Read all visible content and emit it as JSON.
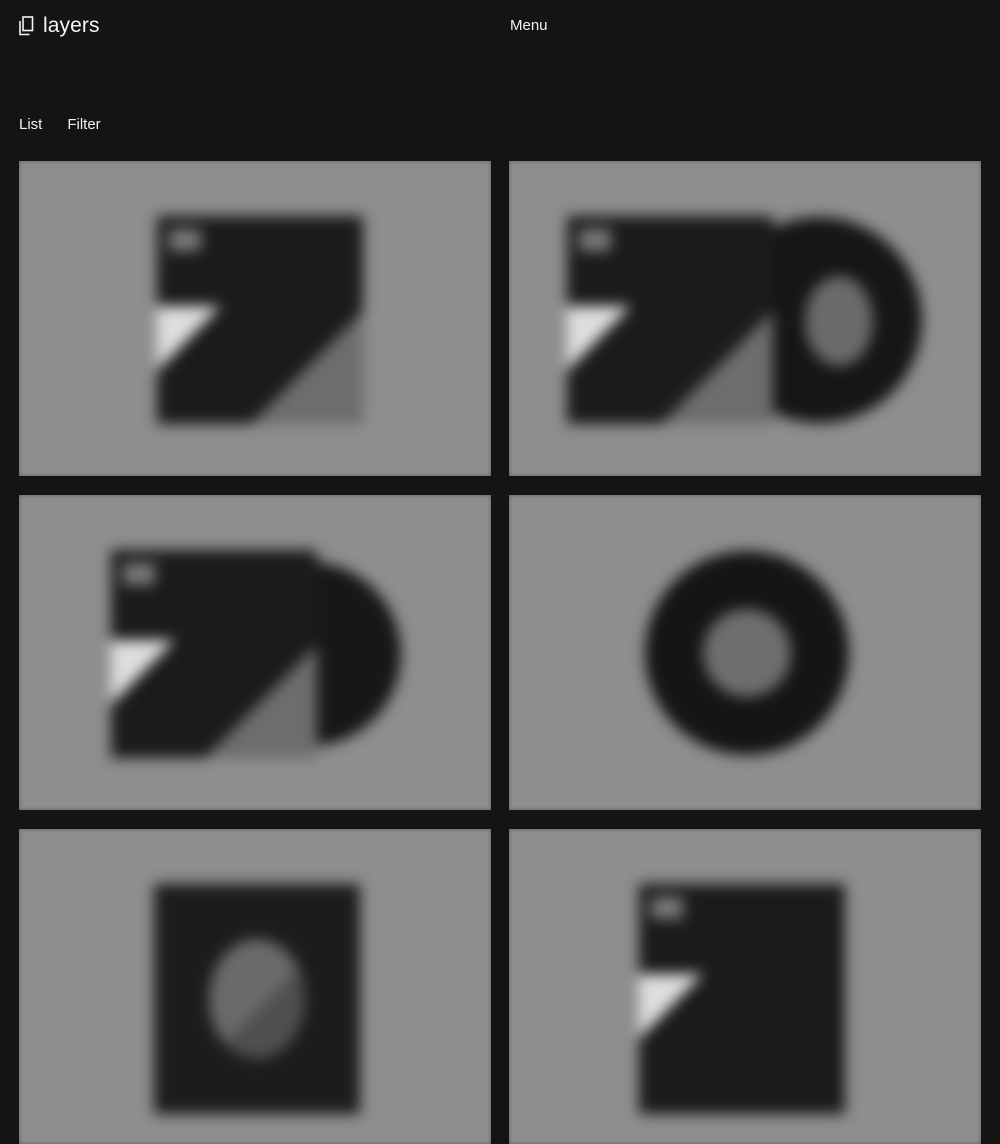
{
  "header": {
    "logo_text": "layers",
    "logo_icon": "layers-icon",
    "menu_label": "Menu"
  },
  "view_controls": {
    "list_label": "List",
    "filter_label": "Filter"
  },
  "gallery": {
    "items": [
      {
        "variant": "sleeve"
      },
      {
        "variant": "sleeve-with-record"
      },
      {
        "variant": "sleeve-with-record-partial"
      },
      {
        "variant": "record"
      },
      {
        "variant": "sleeve-label-only"
      },
      {
        "variant": "sleeve"
      }
    ]
  },
  "colors": {
    "background": "#141414",
    "card": "#8e8e8e",
    "text": "#f2f2f2"
  }
}
